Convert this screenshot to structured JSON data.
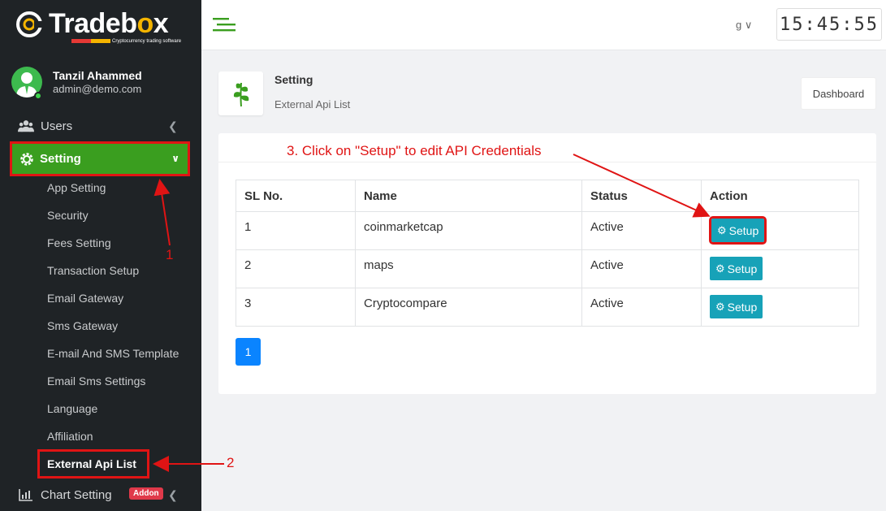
{
  "brand": {
    "name_prefix": "Trade",
    "name_mid": "b",
    "name_accent": "o",
    "name_suffix": "x",
    "tagline": "Cryptocurrency trading software"
  },
  "profile": {
    "name": "Tanzil Ahammed",
    "email": "admin@demo.com"
  },
  "sidebar": {
    "users_label": "Users",
    "setting_label": "Setting",
    "sub_items": [
      "App Setting",
      "Security",
      "Fees Setting",
      "Transaction Setup",
      "Email Gateway",
      "Sms Gateway",
      "E-mail And SMS Template",
      "Email Sms Settings",
      "Language",
      "Affiliation",
      "External Api List"
    ],
    "chart_label": "Chart Setting",
    "addon_badge": "Addon"
  },
  "topbar": {
    "lang": "g",
    "clock": "15:45:55"
  },
  "header": {
    "title": "Setting",
    "subtitle": "External Api List",
    "dashboard_button": "Dashboard"
  },
  "table": {
    "headers": [
      "SL No.",
      "Name",
      "Status",
      "Action"
    ],
    "rows": [
      {
        "sl": "1",
        "name": "coinmarketcap",
        "status": "Active",
        "action": "Setup"
      },
      {
        "sl": "2",
        "name": "maps",
        "status": "Active",
        "action": "Setup"
      },
      {
        "sl": "3",
        "name": "Cryptocompare",
        "status": "Active",
        "action": "Setup"
      }
    ]
  },
  "pagination": {
    "current": "1"
  },
  "annotations": {
    "step1": "1",
    "step2": "2",
    "step3": "3. Click on \"Setup\" to edit API Credentials"
  },
  "colors": {
    "sidebar_bg": "#1f2326",
    "active_green": "#3a9e1f",
    "setup_button": "#17a2b8",
    "annotation_red": "#e01414",
    "pager_blue": "#0a84ff"
  }
}
